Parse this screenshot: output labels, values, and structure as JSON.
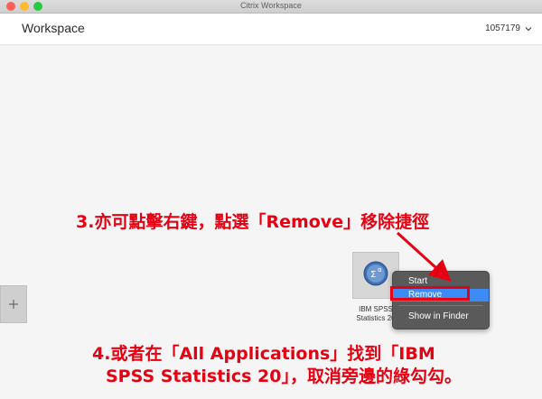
{
  "window": {
    "title": "Citrix Workspace"
  },
  "header": {
    "app_name": "Workspace",
    "username": "1057179"
  },
  "app_tile": {
    "label_line1": "IBM SPSS",
    "label_line2": "Statistics 20"
  },
  "context_menu": {
    "items": [
      "Start",
      "Remove",
      "Show in Finder"
    ],
    "selected": "Remove"
  },
  "annotations": {
    "step3": "3.亦可點擊右鍵，點選「Remove」移除捷徑",
    "step4_line1": "4.或者在「All Applications」找到「IBM",
    "step4_line2": "SPSS Statistics 20」，取消旁邊的綠勾勾。"
  },
  "colors": {
    "annotation": "#e60012",
    "menu_highlight": "#3d8bf5"
  }
}
